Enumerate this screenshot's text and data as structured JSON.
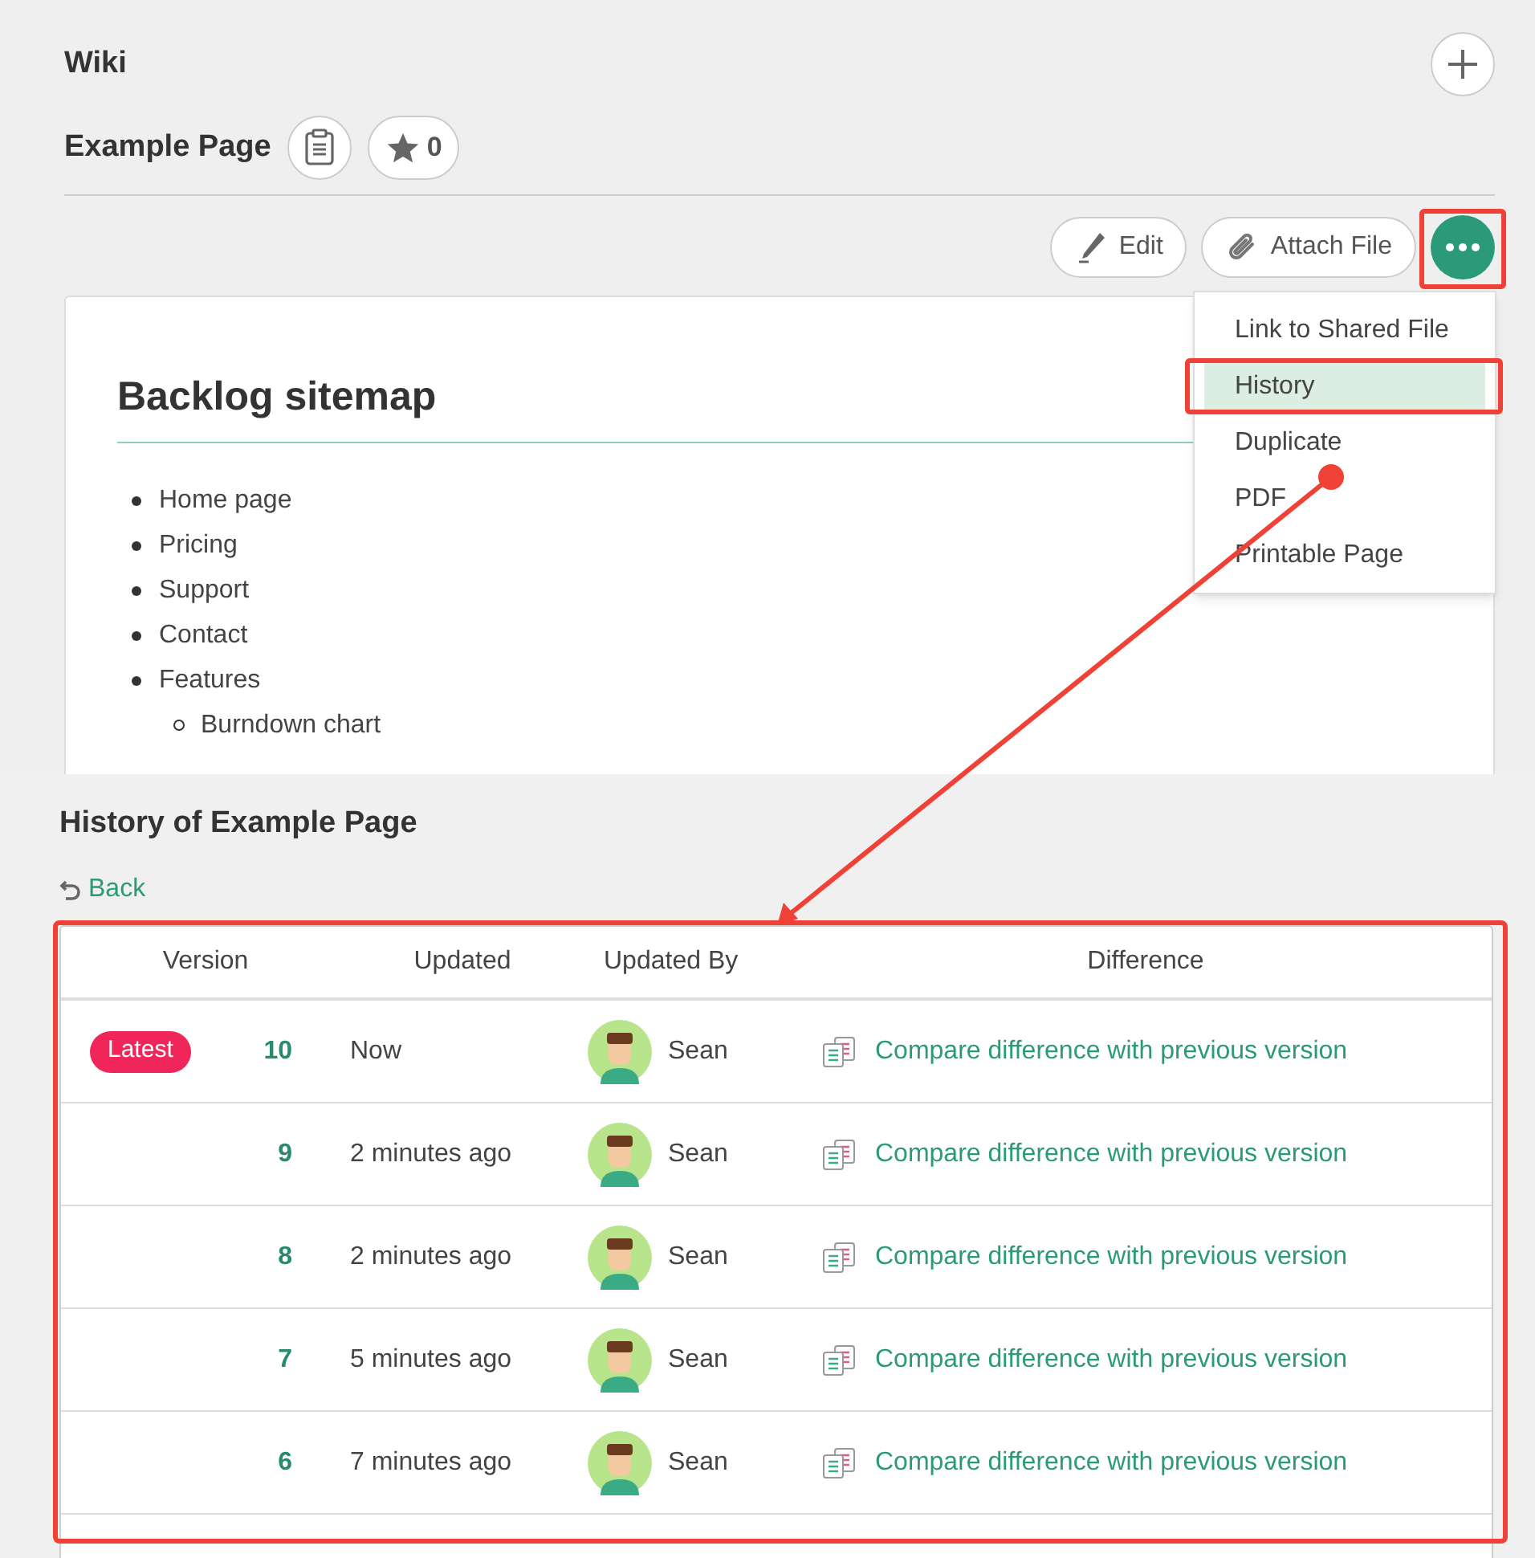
{
  "wiki": {
    "title": "Wiki"
  },
  "page": {
    "title": "Example Page",
    "star_count": "0"
  },
  "actions": [
    {
      "label": "Edit",
      "kind": "edit"
    },
    {
      "label": "Attach File",
      "kind": "attach"
    }
  ],
  "menu": {
    "items": [
      {
        "label": "Link to Shared File",
        "selected": false
      },
      {
        "label": "History",
        "selected": true
      },
      {
        "label": "Duplicate",
        "selected": false
      },
      {
        "label": "PDF",
        "selected": false
      },
      {
        "label": "Printable Page",
        "selected": false
      }
    ]
  },
  "content": {
    "heading": "Backlog sitemap",
    "items": [
      {
        "text": "Home page"
      },
      {
        "text": "Pricing"
      },
      {
        "text": "Support"
      },
      {
        "text": "Contact"
      },
      {
        "text": "Features",
        "children": [
          {
            "text": "Burndown chart"
          }
        ]
      }
    ]
  },
  "history": {
    "title": "History of Example Page",
    "back": "Back",
    "columns": [
      "Version",
      "Updated",
      "Updated By",
      "Difference"
    ],
    "rows": [
      {
        "badge": "Latest",
        "version": "10",
        "updated": "Now",
        "user": "Sean",
        "difference": "Compare difference with previous version"
      },
      {
        "version": "9",
        "updated": "2 minutes ago",
        "user": "Sean",
        "difference": "Compare difference with previous version"
      },
      {
        "version": "8",
        "updated": "2 minutes ago",
        "user": "Sean",
        "difference": "Compare difference with previous version"
      },
      {
        "version": "7",
        "updated": "5 minutes ago",
        "user": "Sean",
        "difference": "Compare difference with previous version"
      },
      {
        "version": "6",
        "updated": "7 minutes ago",
        "user": "Sean",
        "difference": "Compare difference with previous version"
      }
    ]
  }
}
